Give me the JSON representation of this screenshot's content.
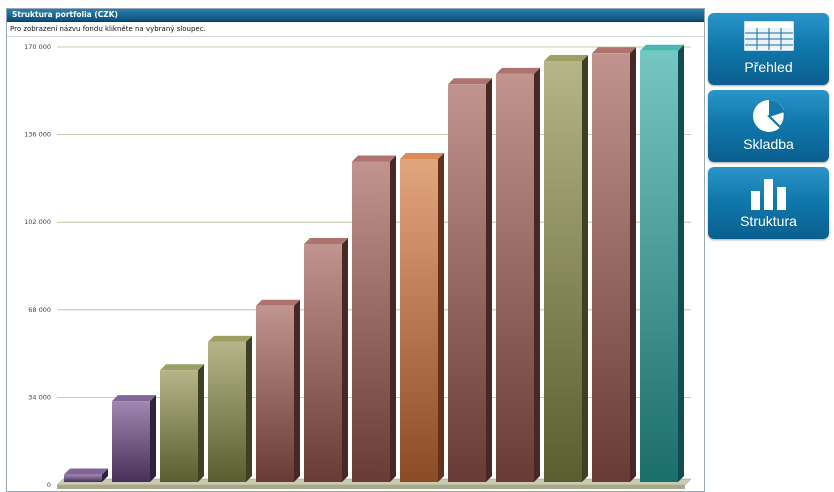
{
  "panel": {
    "title": "Struktura portfolia (CZK)",
    "instruction": "Pro zobrazení názvu fondu klikněte na vybraný sloupec."
  },
  "nav": [
    {
      "label": "Přehled",
      "icon": "table-icon"
    },
    {
      "label": "Skladba",
      "icon": "pie-chart-icon"
    },
    {
      "label": "Struktura",
      "icon": "bar-chart-icon"
    }
  ],
  "chart_data": {
    "type": "bar",
    "title": "Struktura portfolia (CZK)",
    "ylim": [
      0,
      170000
    ],
    "yticks": [
      0,
      34000,
      68000,
      102000,
      136000,
      170000
    ],
    "ytick_labels": [
      "0",
      "34 000",
      "68 000",
      "102 000",
      "136 000",
      "170 000"
    ],
    "grid": true,
    "values": [
      2500,
      31000,
      43000,
      54000,
      68000,
      92000,
      124000,
      125000,
      154000,
      158000,
      163000,
      166000,
      167000
    ],
    "colors": [
      "#6b4a86",
      "#6b4a86",
      "#8b8f4a",
      "#8b8f4a",
      "#a05a52",
      "#a05a52",
      "#a05a52",
      "#d4743a",
      "#a05a52",
      "#a05a52",
      "#8b8f4a",
      "#a05a52",
      "#2aa9a4"
    ]
  }
}
